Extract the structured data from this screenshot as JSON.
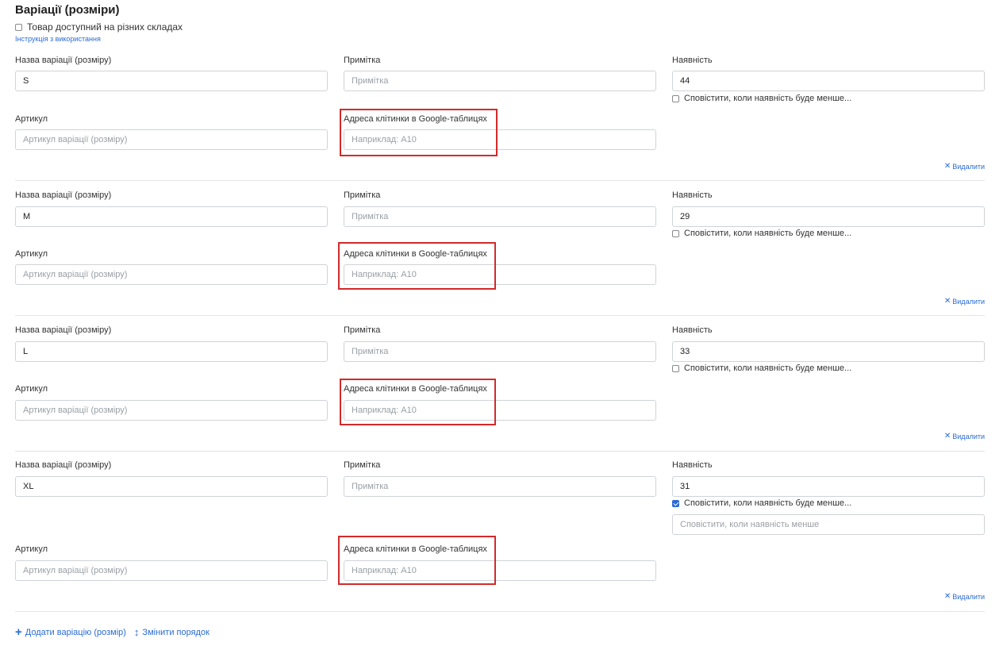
{
  "section": {
    "title": "Варіації (розміри)",
    "multi_warehouse_label": "Товар доступний на різних складах",
    "help_link": "Інструкція з використання"
  },
  "labels": {
    "name": "Назва варіації (розміру)",
    "note": "Примітка",
    "stock": "Наявність",
    "sku": "Артикул",
    "gcell": "Адреса клітинки в Google-таблицях",
    "notify": "Сповістити, коли наявність буде менше..."
  },
  "placeholders": {
    "note": "Примітка",
    "sku": "Артикул варіації (розміру)",
    "gcell": "Наприклад: A10",
    "notify_threshold": "Сповістити, коли наявність менше"
  },
  "variations": [
    {
      "name": "S",
      "stock": "44",
      "notify_checked": false
    },
    {
      "name": "M",
      "stock": "29",
      "notify_checked": false
    },
    {
      "name": "L",
      "stock": "33",
      "notify_checked": false
    },
    {
      "name": "XL",
      "stock": "31",
      "notify_checked": true
    }
  ],
  "delete_label": "Видалити",
  "footer": {
    "add_label": "Додати варіацію (розмір)",
    "reorder_label": "Змінити порядок"
  },
  "colors": {
    "accent": "#2a6bd6",
    "highlight": "#d32a2a"
  }
}
